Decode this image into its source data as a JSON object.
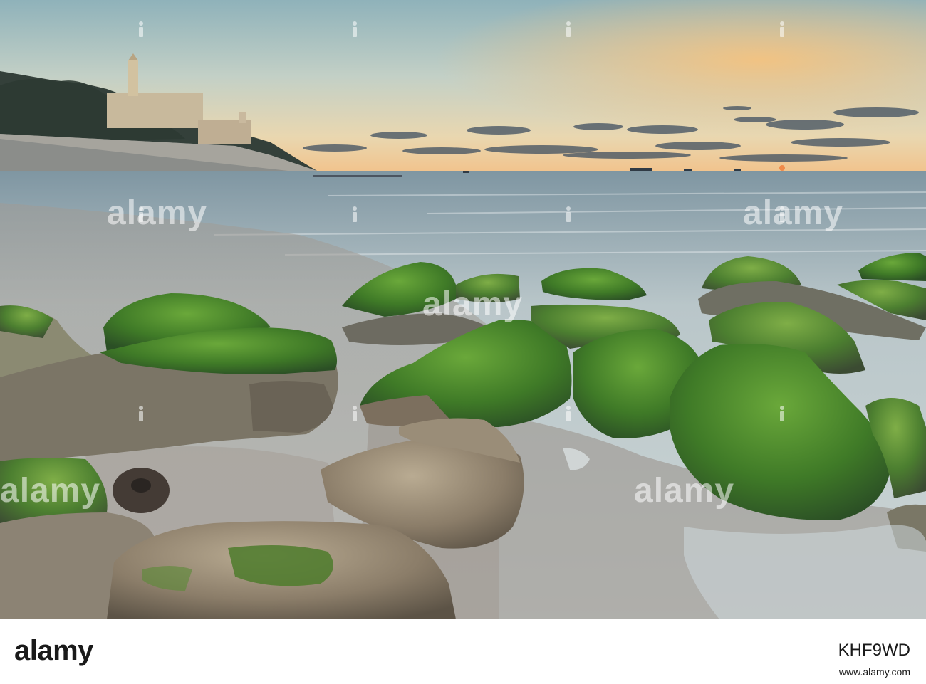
{
  "photo": {
    "subject": "seascape-at-sunset",
    "colors": {
      "sky_top": "#8fb3bb",
      "sky_mid": "#d7d9c1",
      "horizon_glow": "#f3c78e",
      "sea": "#b7c3c6",
      "sand": "#a59d93",
      "moss": "#4f8a2d",
      "rock": "#7d7466"
    }
  },
  "watermark": {
    "word": "alamy"
  },
  "footer": {
    "logo": "alamy",
    "image_id": "KHF9WD",
    "url": "www.alamy.com"
  }
}
